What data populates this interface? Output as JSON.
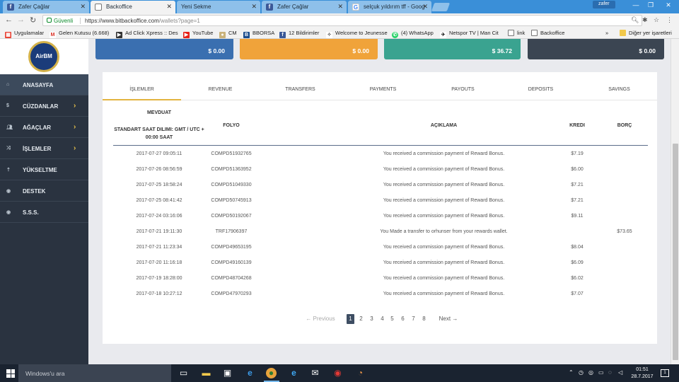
{
  "browser": {
    "tabs": [
      {
        "title": "Zafer Çağlar",
        "icon": "facebook-icon"
      },
      {
        "title": "Backoffice",
        "icon": "document-icon"
      },
      {
        "title": "Yeni Sekme",
        "icon": "none"
      },
      {
        "title": "Zafer Çağlar",
        "icon": "facebook-icon"
      },
      {
        "title": "selçuk yıldırım tff - Goog",
        "icon": "google-icon"
      }
    ],
    "user": "zafer",
    "secure_label": "Güvenli",
    "url_host": "https://www.bitbackoffice.com",
    "url_path": "/wallets?page=1",
    "bookmarks": [
      "Uygulamalar",
      "Gelen Kutusu (6.668)",
      "Ad Click Xpress :: Des",
      "YouTube",
      "CM",
      "BBORSA",
      "12 Bildirimler",
      "Welcome to Jeunesse",
      "(4) WhatsApp",
      "Netspor TV | Man Cit",
      "link",
      "Backoffice"
    ],
    "other_bookmarks": "Diğer yer işaretleri"
  },
  "logo_text": "AirBM",
  "sidebar": [
    {
      "label": "ANASAYFA",
      "icon": "home-icon",
      "arrow": ""
    },
    {
      "label": "CÜZDANLAR",
      "icon": "dollar-icon",
      "arrow": "›"
    },
    {
      "label": "AĞAÇLAR",
      "icon": "users-icon",
      "arrow": "›"
    },
    {
      "label": "İŞLEMLER",
      "icon": "shuffle-icon",
      "arrow": "›"
    },
    {
      "label": "YÜKSELTME",
      "icon": "upgrade-icon",
      "arrow": ""
    },
    {
      "label": "DESTEK",
      "icon": "support-icon",
      "arrow": ""
    },
    {
      "label": "S.S.S.",
      "icon": "faq-icon",
      "arrow": ""
    }
  ],
  "cards": [
    {
      "amount": "$ 0.00",
      "color": "#3a6fb0"
    },
    {
      "amount": "$ 0.00",
      "color": "#f0a33a"
    },
    {
      "amount": "$ 36.72",
      "color": "#3aa390"
    },
    {
      "amount": "$ 0.00",
      "color": "#3b4552"
    }
  ],
  "tabs": [
    "İŞLEMLER",
    "REVENUE",
    "TRANSFERS",
    "PAYMENTS",
    "PAYOUTS",
    "DEPOSITS",
    "SAVINGS"
  ],
  "active_tab": "İŞLEMLER",
  "table": {
    "col_date_1": "MEVDUAT",
    "col_date_2": "STANDART SAAT DILIMI: GMT / UTC + 00:00 SAAT",
    "col_folyo": "FOLYO",
    "col_desc": "AÇIKLAMA",
    "col_kredi": "KREDI",
    "col_borc": "BORÇ",
    "rows": [
      {
        "date": "2017-07-27 09:05:11",
        "folyo": "COMPD51932765",
        "desc": "You received a commission payment of Reward Bonus.",
        "kredi": "$7.19",
        "borc": ""
      },
      {
        "date": "2017-07-26 08:56:59",
        "folyo": "COMPD51363952",
        "desc": "You received a commission payment of Reward Bonus.",
        "kredi": "$6.00",
        "borc": ""
      },
      {
        "date": "2017-07-25 18:58:24",
        "folyo": "COMPD51049330",
        "desc": "You received a commission payment of Reward Bonus.",
        "kredi": "$7.21",
        "borc": ""
      },
      {
        "date": "2017-07-25 08:41:42",
        "folyo": "COMPD50745913",
        "desc": "You received a commission payment of Reward Bonus.",
        "kredi": "$7.21",
        "borc": ""
      },
      {
        "date": "2017-07-24 03:16:06",
        "folyo": "COMPD50192067",
        "desc": "You received a commission payment of Reward Bonus.",
        "kredi": "$9.11",
        "borc": ""
      },
      {
        "date": "2017-07-21 19:11:30",
        "folyo": "TRF17906397",
        "desc": "You Made a transfer to orhunser from your rewards wallet.",
        "kredi": "",
        "borc": "$73.65"
      },
      {
        "date": "2017-07-21 11:23:34",
        "folyo": "COMPD49653195",
        "desc": "You received a commission payment of Reward Bonus.",
        "kredi": "$8.04",
        "borc": ""
      },
      {
        "date": "2017-07-20 11:16:18",
        "folyo": "COMPD49160139",
        "desc": "You received a commission payment of Reward Bonus.",
        "kredi": "$6.09",
        "borc": ""
      },
      {
        "date": "2017-07-19 18:28:00",
        "folyo": "COMPD48704268",
        "desc": "You received a commission payment of Reward Bonus.",
        "kredi": "$6.02",
        "borc": ""
      },
      {
        "date": "2017-07-18 10:27:12",
        "folyo": "COMPD47970293",
        "desc": "You received a commission payment of Reward Bonus.",
        "kredi": "$7.07",
        "borc": ""
      }
    ]
  },
  "pagination": {
    "prev": "← Previous",
    "next": "Next →",
    "pages": [
      "1",
      "2",
      "3",
      "4",
      "5",
      "6",
      "7",
      "8"
    ],
    "current": "1"
  },
  "taskbar": {
    "search_placeholder": "Windows'u ara",
    "time": "01:51",
    "date": "28.7.2017"
  }
}
